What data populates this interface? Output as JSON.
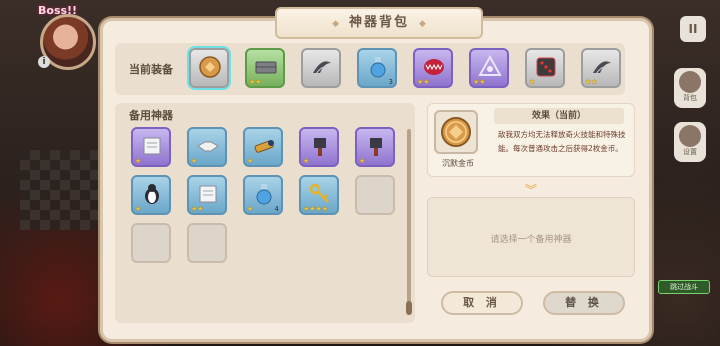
{
  "hud": {
    "boss_label": "Boss!!",
    "info_glyph": "i",
    "pause_glyph": "II",
    "side_buttons": [
      {
        "icon": "backpack-icon",
        "label": "背包"
      },
      {
        "icon": "settings-icon",
        "label": "设置"
      }
    ],
    "skip_label": "跳过战斗"
  },
  "panel": {
    "title": "神器背包",
    "title_deco": "◆",
    "close_glyph": "✕",
    "equipped_label": "当前装备",
    "reserve_label": "备用神器",
    "cancel_label": "取 消",
    "confirm_label": "替 换",
    "select_hint": "请选择一个备用神器"
  },
  "equipped": [
    {
      "name": "沉默金币",
      "rarity": "gray",
      "icon": "gold-coin-icon",
      "stars": "",
      "selected": true
    },
    {
      "name": "",
      "rarity": "green",
      "icon": "stone-brick-icon",
      "stars": "★★",
      "count": ""
    },
    {
      "name": "",
      "rarity": "gray",
      "icon": "claw-icon",
      "stars": "",
      "count": ""
    },
    {
      "name": "",
      "rarity": "blue",
      "icon": "potion-bottle-icon",
      "stars": "",
      "count": "3"
    },
    {
      "name": "",
      "rarity": "purple",
      "icon": "monster-mouth-icon",
      "stars": "★★",
      "count": ""
    },
    {
      "name": "",
      "rarity": "purple",
      "icon": "arcane-sigil-icon",
      "stars": "★★",
      "count": ""
    },
    {
      "name": "",
      "rarity": "gray",
      "icon": "dice-icon",
      "stars": "★",
      "count": ""
    },
    {
      "name": "",
      "rarity": "gray",
      "icon": "claw-icon",
      "stars": "★★",
      "count": ""
    }
  ],
  "reserve": [
    {
      "rarity": "purple",
      "icon": "scroll-paper-icon",
      "stars": "★",
      "count": ""
    },
    {
      "rarity": "blue",
      "icon": "handshake-icon",
      "stars": "★",
      "count": ""
    },
    {
      "rarity": "blue",
      "icon": "telescope-icon",
      "stars": "★",
      "count": ""
    },
    {
      "rarity": "purple",
      "icon": "cleaver-icon",
      "stars": "★",
      "count": ""
    },
    {
      "rarity": "purple",
      "icon": "cleaver-icon",
      "stars": "★",
      "count": ""
    },
    {
      "rarity": "blue",
      "icon": "penguin-icon",
      "stars": "★",
      "count": ""
    },
    {
      "rarity": "blue",
      "icon": "scroll-paper-icon",
      "stars": "★★",
      "count": ""
    },
    {
      "rarity": "blue",
      "icon": "potion-bottle-icon",
      "stars": "★",
      "count": "4"
    },
    {
      "rarity": "blue",
      "icon": "golden-key-icon",
      "stars": "★★★★",
      "count": ""
    },
    {
      "rarity": "empty",
      "icon": "",
      "stars": "",
      "count": ""
    },
    {
      "rarity": "empty",
      "icon": "",
      "stars": "",
      "count": ""
    },
    {
      "rarity": "empty",
      "icon": "",
      "stars": "",
      "count": ""
    }
  ],
  "detail": {
    "name": "沉默金币",
    "effect_title": "效果（当前）",
    "effect_text": "敌我双方均无法释放奇火技能和特殊技能。每次普通攻击之后获得2枚金币。"
  },
  "colors": {
    "panel_bg": "#f5ecdf",
    "star": "#f3c230",
    "selected_glow": "#6fe0e8",
    "effect_text": "#6b3b2a"
  }
}
